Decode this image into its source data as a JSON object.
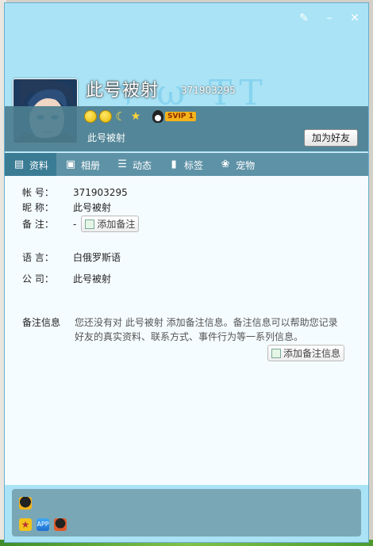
{
  "window": {
    "controls": [
      "skin-icon",
      "minimize-icon",
      "close-icon"
    ]
  },
  "profile": {
    "nickname": "此号被射",
    "qq_number": "371903295",
    "signature": "此号被射",
    "vip_badge": "SVIP 1",
    "add_friend_label": "加为好友",
    "banner_deco": "ד ω TT"
  },
  "tabs": [
    {
      "label": "资料",
      "icon": "id-card-icon"
    },
    {
      "label": "相册",
      "icon": "album-icon"
    },
    {
      "label": "动态",
      "icon": "feed-icon"
    },
    {
      "label": "标签",
      "icon": "bookmark-icon"
    },
    {
      "label": "宠物",
      "icon": "pet-icon"
    }
  ],
  "details": {
    "account_label": "帐    号：",
    "account_value": "371903295",
    "nick_label": "昵    称：",
    "nick_value": "此号被射",
    "remark_label": "备    注：",
    "remark_value": "-",
    "add_remark_label": "添加备注",
    "language_label": "语    言：",
    "language_value": "白俄罗斯语",
    "company_label": "公    司：",
    "company_value": "此号被射"
  },
  "note": {
    "title": "备注信息",
    "text": "您还没有对 此号被射 添加备注信息。备注信息可以帮助您记录好友的真实资料、联系方式、事件行为等一系列信息。",
    "button_label": "添加备注信息"
  },
  "colors": {
    "accent": "#5e92a6",
    "banner": "#a9e3f5",
    "vip": "#f3b31a"
  }
}
